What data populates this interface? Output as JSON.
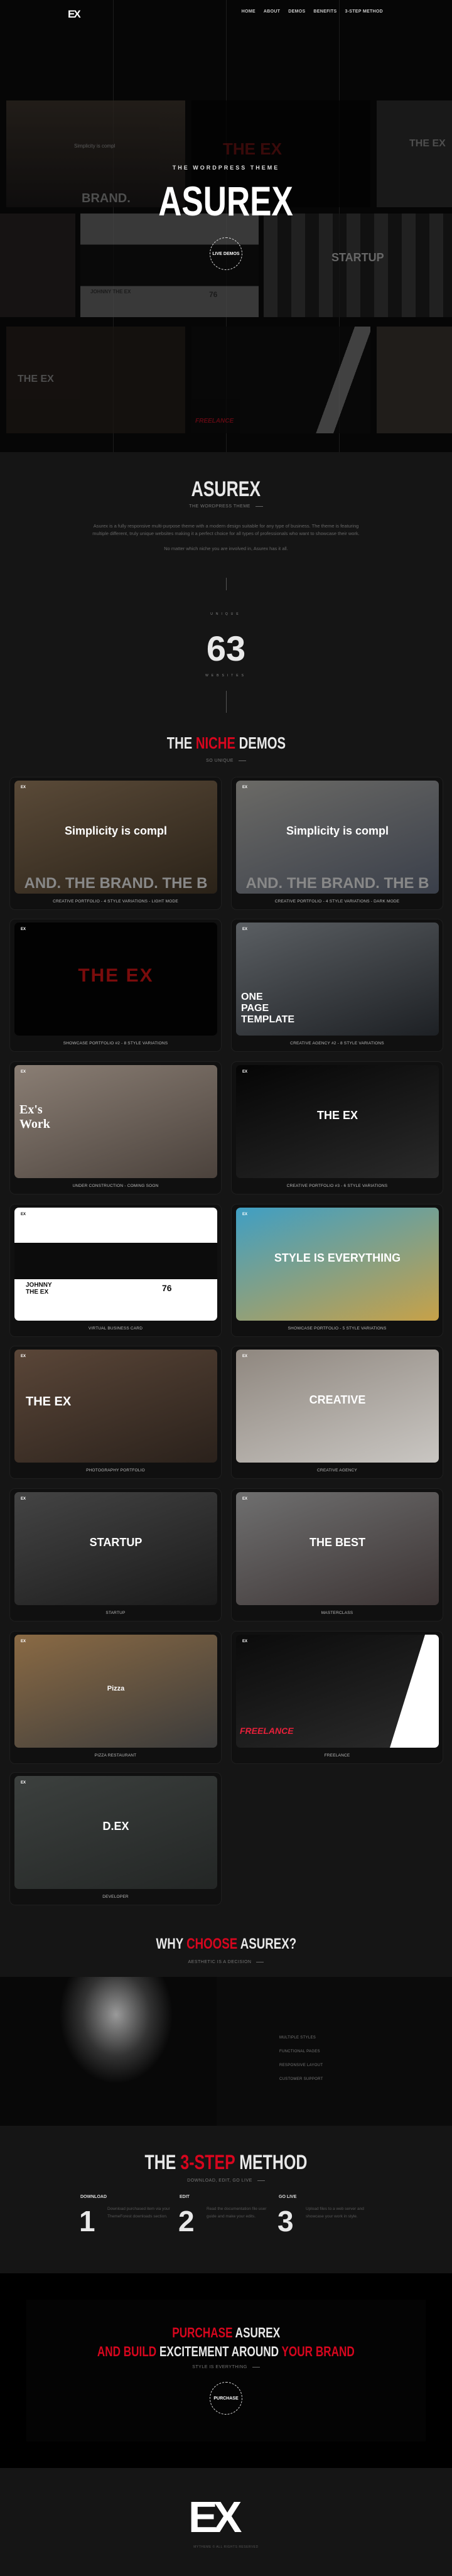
{
  "header": {
    "logo": "EX",
    "nav": [
      "HOME",
      "ABOUT",
      "DEMOS",
      "BENEFITS",
      "3-STEP METHOD"
    ]
  },
  "hero": {
    "kicker": "THE WORDPRESS THEME",
    "title": "ASUREX",
    "cta": "LIVE DEMOS",
    "mosaic": [
      "Simplicity is compl",
      "BRAND.",
      "THE EX",
      "THE EX",
      "STARTUP",
      "JOHNNY THE EX",
      "76",
      "THE EX",
      "FREELANCE"
    ]
  },
  "intro": {
    "title": "ASUREX",
    "subtitle": "THE WORDPRESS THEME",
    "paragraph": "Asurex is a fully responsive multi-purpose theme with a modern design suitable for any type of business. The theme is featuring multiple different, truly unique websites making it a perfect choice for all types of professionals who want to showcase their work.",
    "paragraph2": "No matter which niche you are involved in, Asurex has it all."
  },
  "counter": {
    "top_label": "UNIQUE",
    "value": "63",
    "bottom_label": "WEBSITES"
  },
  "demos_section": {
    "title_pre": "THE",
    "title_accent": "NICHE",
    "title_post": "DEMOS",
    "subtitle": "SO UNIQUE"
  },
  "demos": [
    {
      "caption": "CREATIVE PORTFOLIO - 4 STYLE VARIATIONS - LIGHT MODE",
      "overlay": "Simplicity is compl",
      "band": "AND.  THE  BRAND.  THE  B",
      "bg": [
        "#5a4a38",
        "#2a2218"
      ]
    },
    {
      "caption": "CREATIVE PORTFOLIO - 4 STYLE VARIATIONS - DARK MODE",
      "overlay": "Simplicity is compl",
      "band": "AND.  THE  BRAND.  THE  B",
      "bg": [
        "#6b6a66",
        "#3a3f4a"
      ]
    },
    {
      "caption": "SHOWCASE PORTFOLIO #2 - 8 STYLE VARIATIONS",
      "overlay": "THE EX",
      "bg": [
        "#020202",
        "#020202"
      ]
    },
    {
      "caption": "CREATIVE AGENCY #2 - 8 STYLE VARIATIONS",
      "overlay": "ONE PAGE TEMPLATE",
      "bg": [
        "#5b5f63",
        "#1d2024"
      ]
    },
    {
      "caption": "UNDER CONSTRUCTION - COMING SOON",
      "overlay": "Ex's Work",
      "bg": [
        "#8a7e74",
        "#4b423c"
      ]
    },
    {
      "caption": "CREATIVE PORTFOLIO #3 - 6 STYLE VARIATIONS",
      "overlay": "THE EX",
      "bg": [
        "#050505",
        "#2a2a2a"
      ]
    },
    {
      "caption": "VIRTUAL BUSINESS CARD",
      "overlay": "JOHNNY THE EX",
      "stat": "76",
      "bg": [
        "#ffffff",
        "#ffffff"
      ]
    },
    {
      "caption": "SHOWCASE PORTFOLIO - 5 STYLE VARIATIONS",
      "overlay": "STYLE IS EVERYTHING",
      "bg": [
        "#3f9fc4",
        "#c7a148"
      ]
    },
    {
      "caption": "PHOTOGRAPHY PORTFOLIO",
      "overlay": "THE EX",
      "bg": [
        "#5a4638",
        "#2a211b"
      ]
    },
    {
      "caption": "CREATIVE AGENCY",
      "overlay": "CREATIVE",
      "bg": [
        "#8f877f",
        "#c9c6c2"
      ]
    },
    {
      "caption": "STARTUP",
      "overlay": "STARTUP",
      "bg": [
        "#444444",
        "#1a1a1a"
      ]
    },
    {
      "caption": "MASTERCLASS",
      "overlay": "THE BEST",
      "bg": [
        "#6f6f6f",
        "#3c3434"
      ]
    },
    {
      "caption": "PIZZA RESTAURANT",
      "overlay": "Pizza",
      "bg": [
        "#8a6a44",
        "#3b3b3b"
      ]
    },
    {
      "caption": "FREELANCE",
      "overlay": "FREELANCE",
      "bg": [
        "#0b0b0b",
        "#2b2b2b"
      ]
    },
    {
      "caption": "DEVELOPER",
      "overlay": "D.EX",
      "bg": [
        "#3c403e",
        "#232625"
      ]
    }
  ],
  "why": {
    "title_pre": "WHY",
    "title_accent": "CHOOSE",
    "title_post": "ASUREX?",
    "subtitle": "AESTHETIC IS A DECISION",
    "features": [
      "MULTIPLE STYLES",
      "FUNCTIONAL PAGES",
      "RESPONSIVE LAYOUT",
      "CUSTOMER SUPPORT"
    ]
  },
  "steps": {
    "title_pre": "THE",
    "title_accent": "3-STEP",
    "title_post": "METHOD",
    "subtitle": "DOWNLOAD, EDIT, GO LIVE",
    "items": [
      {
        "label": "DOWNLOAD",
        "number": "1",
        "text": "Download purchased item via your ThemeForest downloads section."
      },
      {
        "label": "EDIT",
        "number": "2",
        "text": "Read the documentation file user guide and make your edits."
      },
      {
        "label": "GO LIVE",
        "number": "3",
        "text": "Upload files to a web server and showcase your work in style."
      }
    ]
  },
  "purchase": {
    "line1_accent": "PURCHASE",
    "line1_rest": "ASUREX",
    "line2_accent1": "AND BUILD",
    "line2_mid": "EXCITEMENT AROUND",
    "line2_accent2": "YOUR BRAND",
    "subtitle": "STYLE IS EVERYTHING",
    "button": "PURCHASE"
  },
  "footer": {
    "logo": "EX",
    "copyright": "MYTHEME © ALL RIGHTS RESERVED"
  },
  "colors": {
    "accent": "#d7061e",
    "bg": "#151515",
    "hero_bg": "#060606"
  }
}
